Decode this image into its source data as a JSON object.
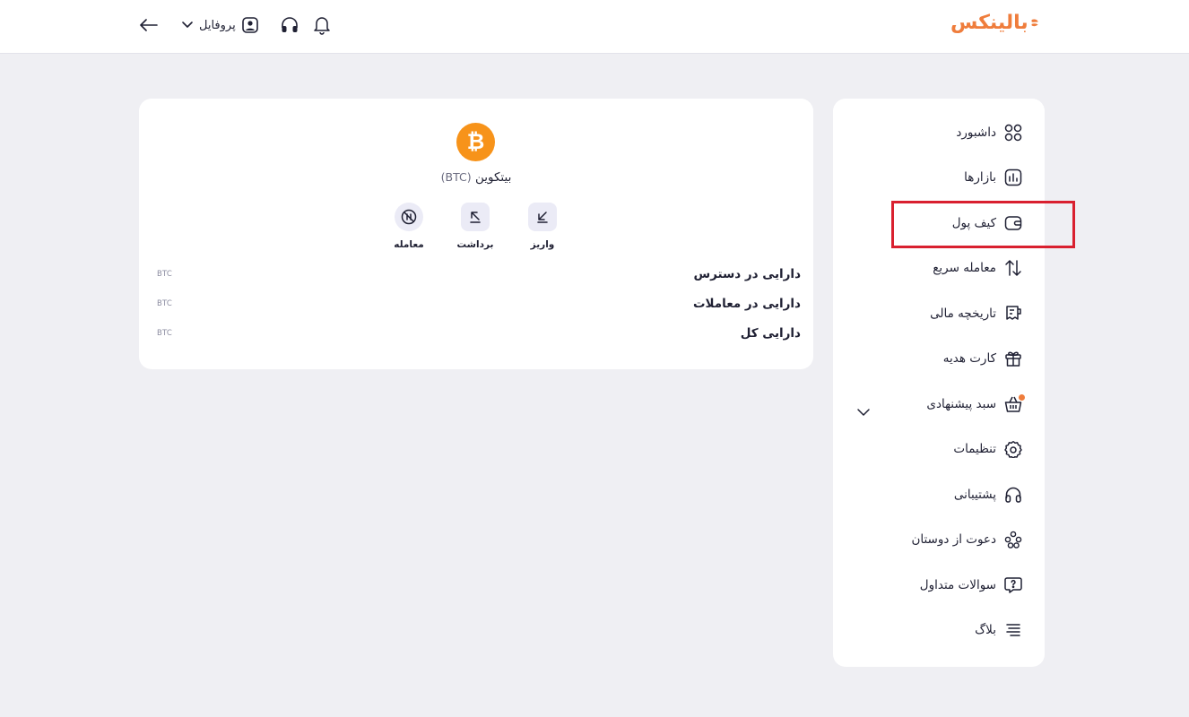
{
  "brand": {
    "name": "بالینکس",
    "color": "#ef7d3c"
  },
  "header": {
    "profile_label": "پروفایل",
    "icons": [
      "back-arrow-icon",
      "chevron-down-icon",
      "user-avatar-icon",
      "headphones-icon",
      "bell-icon"
    ]
  },
  "sidebar": {
    "items": [
      {
        "label": "داشبورد",
        "icon": "dashboard-grid-icon"
      },
      {
        "label": "بازارها",
        "icon": "market-chart-icon"
      },
      {
        "label": "کیف پول",
        "icon": "wallet-icon",
        "highlighted": true
      },
      {
        "label": "معامله سریع",
        "icon": "swap-arrows-icon"
      },
      {
        "label": "تاریخچه مالی",
        "icon": "receipt-icon",
        "expandable": true
      },
      {
        "label": "کارت هدیه",
        "icon": "gift-icon"
      },
      {
        "label": "سبد پیشنهادی",
        "icon": "basket-icon",
        "badge": true
      },
      {
        "label": "تنظیمات",
        "icon": "gear-icon"
      },
      {
        "label": "پشتیبانی",
        "icon": "headphones-icon"
      },
      {
        "label": "دعوت از دوستان",
        "icon": "friends-icon"
      },
      {
        "label": "سوالات متداول",
        "icon": "question-bubble-icon"
      },
      {
        "label": "بلاگ",
        "icon": "blog-lines-icon"
      }
    ],
    "highlight_color": "#d9202f"
  },
  "asset": {
    "name": "بیتکوین",
    "symbol": "(BTC)",
    "coin_color": "#f7931a",
    "actions": [
      {
        "label": "واریز",
        "icon": "deposit-arrow-icon"
      },
      {
        "label": "برداشت",
        "icon": "withdraw-arrow-icon"
      },
      {
        "label": "معامله",
        "icon": "trade-icon"
      }
    ],
    "balances": [
      {
        "label": "دارایی در دسترس",
        "unit": "BTC"
      },
      {
        "label": "دارایی در معاملات",
        "unit": "BTC"
      },
      {
        "label": "دارایی کل",
        "unit": "BTC"
      }
    ]
  }
}
